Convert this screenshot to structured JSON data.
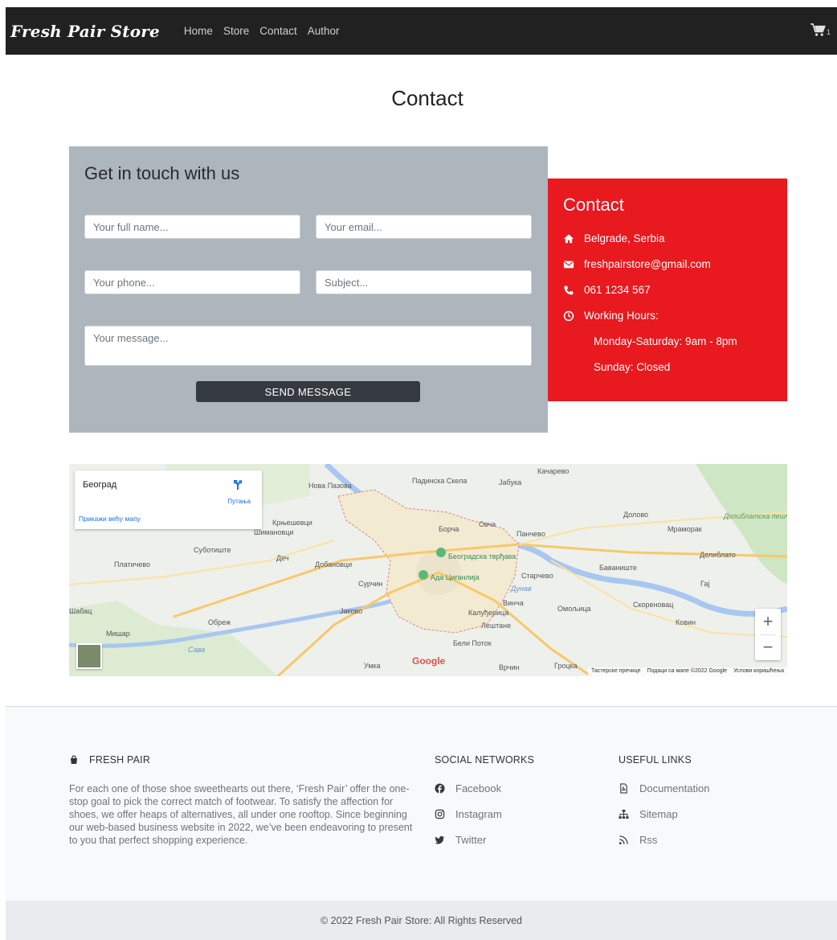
{
  "navbar": {
    "brand": "Fresh Pair Store",
    "links": [
      "Home",
      "Store",
      "Contact",
      "Author"
    ],
    "cart_count": "1"
  },
  "page": {
    "title": "Contact"
  },
  "form": {
    "heading": "Get in touch with us",
    "name_placeholder": "Your full name...",
    "email_placeholder": "Your email...",
    "phone_placeholder": "Your phone...",
    "subject_placeholder": "Subject...",
    "message_placeholder": "Your message...",
    "submit_label": "SEND MESSAGE"
  },
  "contact_info": {
    "heading": "Contact",
    "address": "Belgrade, Serbia",
    "email": "freshpairstore@gmail.com",
    "phone": "061 1234 567",
    "hours_label": "Working Hours:",
    "hours_weekdays": "Monday-Saturday: 9am - 8pm",
    "hours_sunday": "Sunday: Closed"
  },
  "map": {
    "place_title": "Београд",
    "directions_label": "Путања",
    "larger_map_label": "Прикажи већу мапу",
    "labels": [
      "Нова Пазова",
      "Падинска Скела",
      "Јабука",
      "Качарево",
      "Долово",
      "Мраморак",
      "Делиблатска пешчара",
      "Крњешевци",
      "Шимановци",
      "Борча",
      "Овча",
      "Панчево",
      "Суботиште",
      "Деч",
      "Добановци",
      "Београдска тврђава",
      "Делиблато",
      "Платичево",
      "Ада Циганлија",
      "Старчево",
      "Баваниште",
      "Сурчин",
      "Гај",
      "Шабац",
      "Јаково",
      "Винча",
      "Калуђерица",
      "Омољица",
      "Скореновац",
      "Мишар",
      "Обреж",
      "Лештане",
      "Ковин",
      "Сава",
      "Бели Поток",
      "Умка",
      "Врчин",
      "Гроцка",
      "Дунав"
    ],
    "attribution": [
      "Тастерске пречице",
      "Подаци са мапе ©2022 Google",
      "Услови коришћења"
    ],
    "logo": "Google"
  },
  "footer": {
    "brand_heading": "FRESH PAIR",
    "about": "For each one of those shoe sweethearts out there, ‘Fresh Pair’ offer the one-stop goal to pick the correct match of footwear. To satisfy the affection for shoes, we offer heaps of alternatives, all under one rooftop. Since beginning our web-based business website in 2022, we’ve been endeavoring to present to you that perfect shopping experience.",
    "social_heading": "SOCIAL NETWORKS",
    "social": [
      "Facebook",
      "Instagram",
      "Twitter"
    ],
    "useful_heading": "USEFUL LINKS",
    "useful": [
      "Documentation",
      "Sitemap",
      "Rss"
    ],
    "copyright": "© 2022 Fresh Pair Store: All Rights Reserved"
  },
  "colors": {
    "navbar_bg": "#212121",
    "form_panel_bg": "#adb5bd",
    "contact_panel_bg": "#e8191f",
    "button_bg": "#343a40",
    "footer_bg": "#f8f9fa"
  },
  "icons": [
    "cart-icon",
    "home-icon",
    "envelope-icon",
    "phone-icon",
    "clock-icon",
    "directions-icon",
    "zoom-in-icon",
    "zoom-out-icon",
    "shopping-bag-icon",
    "facebook-icon",
    "instagram-icon",
    "twitter-icon",
    "document-icon",
    "sitemap-icon",
    "rss-icon"
  ]
}
